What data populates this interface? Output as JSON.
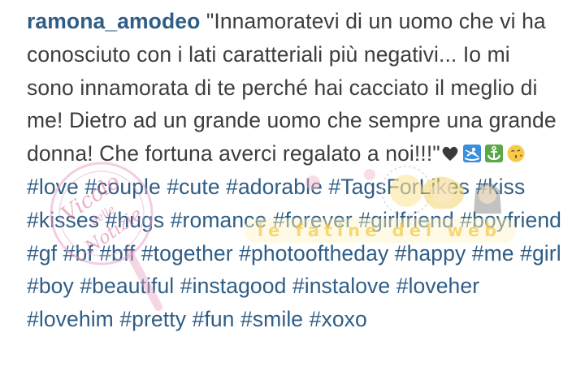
{
  "post": {
    "username": "ramona_amodeo",
    "caption_text": "\"Innamoratevi di un uomo che vi ha conosciuto con i lati caratteriali più negativi... Io mi sono innamorata di te perché hai cacciato il meglio di me! Dietro ad un grande uomo che sempre una grande donna! Che fortuna averci regalato a noi!!!\"",
    "emojis": [
      "heart-icon",
      "rowing-icon",
      "anchor-icon",
      "kiss-face-icon"
    ],
    "hashtags": [
      "#love",
      "#couple",
      "#cute",
      "#adorable",
      "#TagsForLikes",
      "#kiss",
      "#kisses",
      "#hugs",
      "#romance",
      "#forever",
      "#girlfriend",
      "#boyfriend",
      "#gf",
      "#bf",
      "#bff",
      "#together",
      "#photooftheday",
      "#happy",
      "#me",
      "#girl",
      "#boy",
      "#beautiful",
      "#instagood",
      "#instalove",
      "#loveher",
      "#lovehim",
      "#pretty",
      "#fun",
      "#smile",
      "#xoxo"
    ]
  },
  "watermarks": {
    "left_logo": "Vicolo delle Notizie",
    "right_logo": "le fatine del web"
  },
  "colors": {
    "username": "#2f5d86",
    "hashtag": "#2f5d86",
    "text": "#3d3d3d",
    "background": "#ffffff"
  }
}
